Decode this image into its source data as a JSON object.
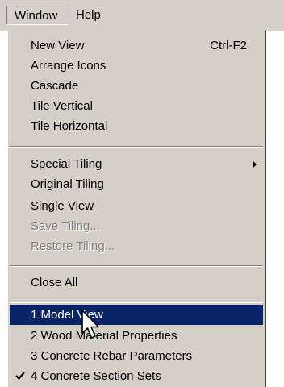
{
  "menubar": {
    "window_label": "Window",
    "help_label": "Help"
  },
  "window_menu": {
    "new_view": "New View",
    "new_view_shortcut": "Ctrl-F2",
    "arrange_icons": "Arrange Icons",
    "cascade": "Cascade",
    "tile_vertical": "Tile Vertical",
    "tile_horizontal": "Tile Horizontal",
    "special_tiling": "Special Tiling",
    "original_tiling": "Original Tiling",
    "single_view": "Single View",
    "save_tiling": "Save Tiling...",
    "restore_tiling": "Restore Tiling...",
    "close_all": "Close All",
    "windows": [
      {
        "label": "1 Model View",
        "selected": true,
        "checked": false
      },
      {
        "label": "2 Wood Material Properties",
        "selected": false,
        "checked": false
      },
      {
        "label": "3 Concrete Rebar Parameters",
        "selected": false,
        "checked": false
      },
      {
        "label": "4 Concrete Section Sets",
        "selected": false,
        "checked": true
      }
    ]
  },
  "icons": {
    "submenu": "submenu-arrow-icon",
    "check": "check-icon",
    "cursor": "mouse-cursor-icon"
  },
  "colors": {
    "menu_bg": "#d4d0c8",
    "highlight_bg": "#0a246a",
    "highlight_text": "#ffffff",
    "disabled_text": "#808080"
  }
}
